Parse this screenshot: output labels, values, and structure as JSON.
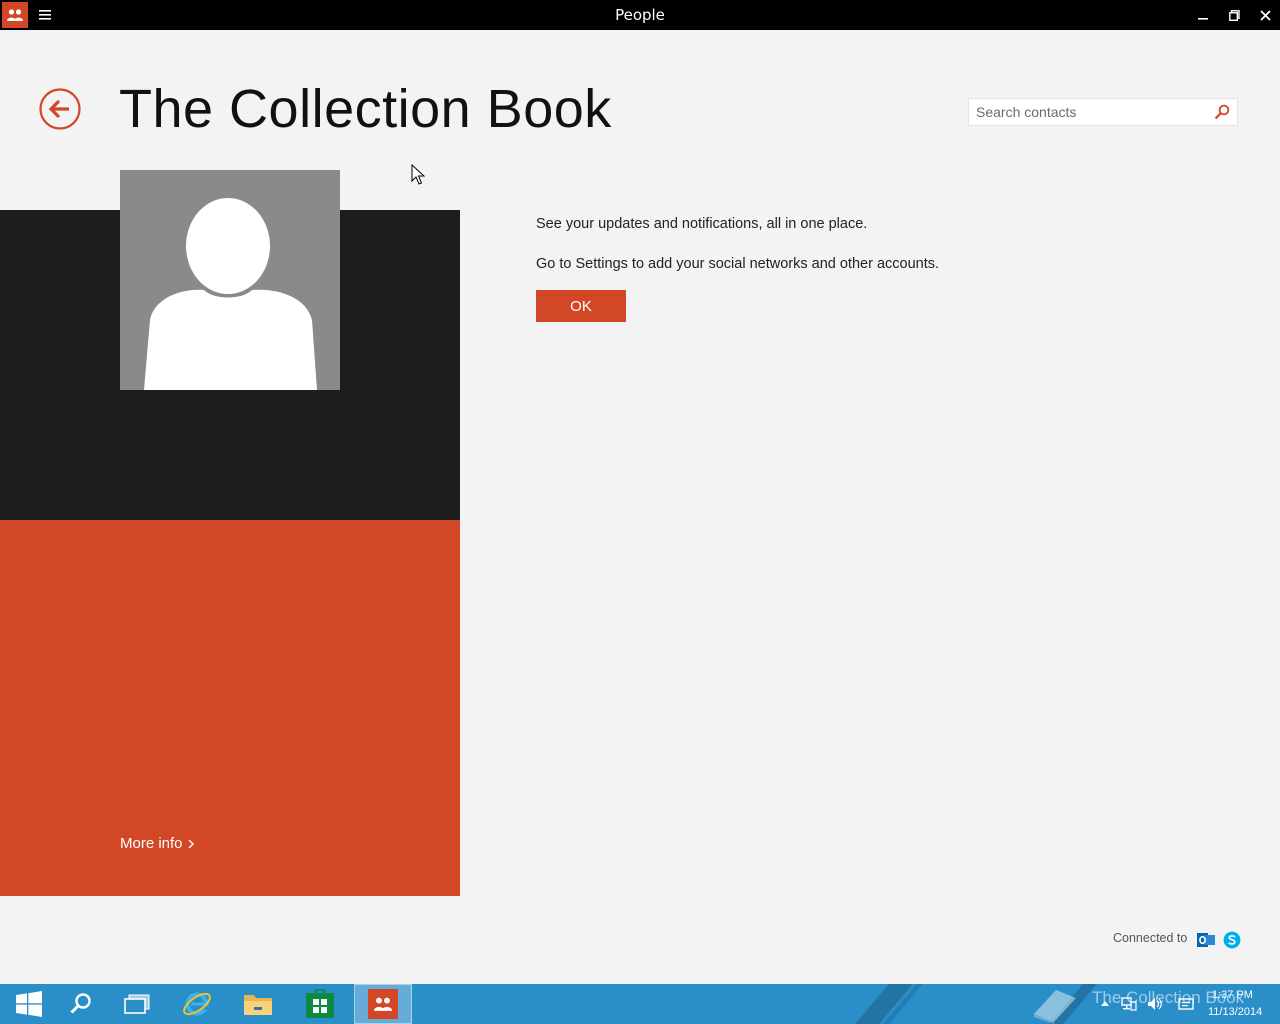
{
  "window": {
    "title": "People",
    "app_icon": "people-icon",
    "menu_icon": "hamburger-icon",
    "controls": [
      "minimize-icon",
      "maximize-icon",
      "close-icon"
    ]
  },
  "header": {
    "back_icon": "back-arrow-icon",
    "title": "The Collection Book",
    "search": {
      "placeholder": "Search contacts",
      "value": "",
      "icon": "search-icon"
    }
  },
  "profile": {
    "avatar_icon": "person-placeholder-icon",
    "more_info_label": "More info",
    "more_info_icon": "chevron-right-icon"
  },
  "notification": {
    "line1": "See your updates and notifications, all in one place.",
    "line2": "Go to Settings to add your social networks and other accounts.",
    "ok_label": "OK"
  },
  "footer": {
    "connected_label": "Connected to",
    "services": [
      "outlook-icon",
      "skype-icon"
    ]
  },
  "colors": {
    "accent": "#d24726",
    "dark_panel": "#1d1d1d",
    "background": "#f3f3f3",
    "taskbar": "#2a8ec9"
  },
  "taskbar": {
    "items": [
      "start-icon",
      "search-icon",
      "task-view-icon",
      "internet-explorer-icon",
      "file-explorer-icon",
      "store-icon",
      "people-icon"
    ],
    "active_item": "people-icon",
    "watermark_text": "The Collection Book",
    "tray": [
      "show-hidden-icons-icon",
      "network-icon",
      "volume-icon",
      "action-center-icon"
    ],
    "time": "1:37 PM",
    "date": "11/13/2014"
  }
}
